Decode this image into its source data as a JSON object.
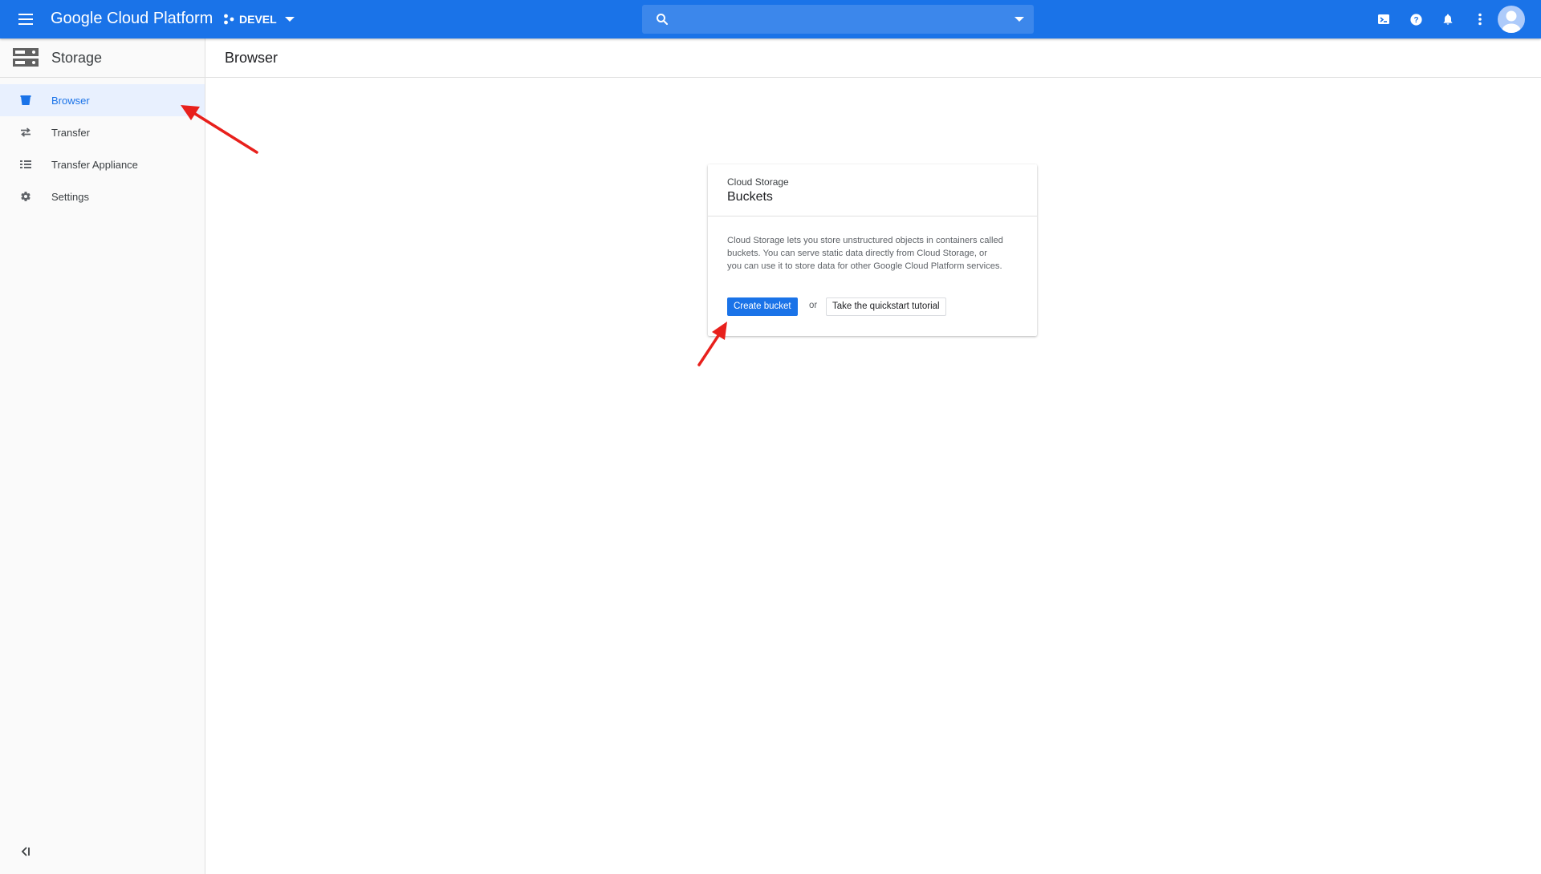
{
  "header": {
    "app_title": "Google Cloud Platform",
    "project_name": "DEVEL",
    "search": {
      "value": "",
      "placeholder": ""
    },
    "icons": [
      "menu-icon",
      "project-icon",
      "search-icon",
      "cloud-shell-icon",
      "help-icon",
      "notifications-icon",
      "more-vert-icon",
      "account-avatar-icon"
    ],
    "accent_color": "#1a73e8"
  },
  "sidebar": {
    "product_title": "Storage",
    "items": [
      {
        "label": "Browser",
        "icon": "bucket-icon",
        "active": true
      },
      {
        "label": "Transfer",
        "icon": "transfer-arrows-icon",
        "active": false
      },
      {
        "label": "Transfer Appliance",
        "icon": "appliance-list-icon",
        "active": false
      },
      {
        "label": "Settings",
        "icon": "gear-icon",
        "active": false
      }
    ]
  },
  "main": {
    "page_title": "Browser",
    "card": {
      "eyebrow": "Cloud Storage",
      "title": "Buckets",
      "description": "Cloud Storage lets you store unstructured objects in containers called buckets. You can serve static data directly from Cloud Storage, or you can use it to store data for other Google Cloud Platform services.",
      "primary_button": "Create bucket",
      "or_text": "or",
      "secondary_button": "Take the quickstart tutorial"
    }
  },
  "annotations": {
    "arrow_color": "#e8201c"
  }
}
